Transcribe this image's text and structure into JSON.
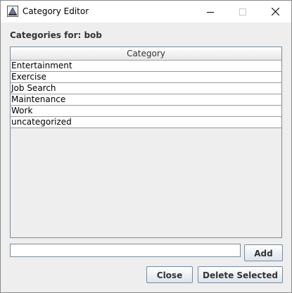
{
  "window": {
    "title": "Category Editor",
    "app_icon": "java-app-icon",
    "controls": {
      "minimize_icon": "minimize-icon",
      "maximize_icon": "maximize-icon",
      "close_icon": "close-icon"
    }
  },
  "heading": "Categories for: bob",
  "table": {
    "column_header": "Category",
    "rows": [
      "Entertainment",
      "Exercise",
      "Job Search",
      "Maintenance",
      "Work",
      "uncategorized"
    ]
  },
  "new_category_input": {
    "value": "",
    "placeholder": ""
  },
  "buttons": {
    "add": "Add",
    "close": "Close",
    "delete_selected": "Delete Selected"
  },
  "colors": {
    "titlebar": "#ffffff",
    "window_background": "#eeeeee",
    "border": "#7a8a99"
  }
}
